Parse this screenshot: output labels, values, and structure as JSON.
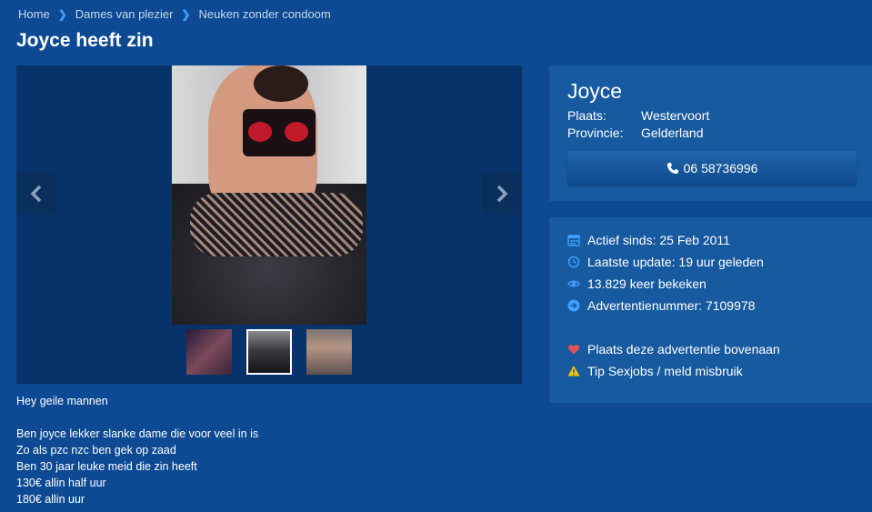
{
  "breadcrumb": {
    "home": "Home",
    "category": "Dames van plezier",
    "sub": "Neuken zonder condoom"
  },
  "page_title": "Joyce heeft zin",
  "gallery": {
    "prev_icon": "chevron-left-icon",
    "next_icon": "chevron-right-icon",
    "thumbnail_count": 3,
    "selected_thumbnail": 2
  },
  "description": [
    "Hey geile mannen",
    "",
    "Ben joyce lekker slanke dame die voor veel in is",
    "Zo als pzc nzc ben gek op zaad",
    "Ben 30 jaar leuke meid die zin heeft",
    "130€ allin half uur",
    "180€ allin uur"
  ],
  "profile": {
    "name": "Joyce",
    "place_label": "Plaats:",
    "place_value": "Westervoort",
    "province_label": "Provincie:",
    "province_value": "Gelderland",
    "phone": "06 58736996"
  },
  "stats": {
    "active_since": "Actief sinds: 25 Feb 2011",
    "last_update": "Laatste update: 19 uur geleden",
    "views": "13.829 keer bekeken",
    "ad_number": "Advertentienummer: 7109978",
    "promote": "Plaats deze advertentie bovenaan",
    "report": "Tip Sexjobs / meld misbruik"
  },
  "colors": {
    "background": "#0d4a93",
    "card": "#175a9f",
    "accent": "#3ea0ff",
    "heart": "#e8505b",
    "warning": "#f5c800"
  }
}
